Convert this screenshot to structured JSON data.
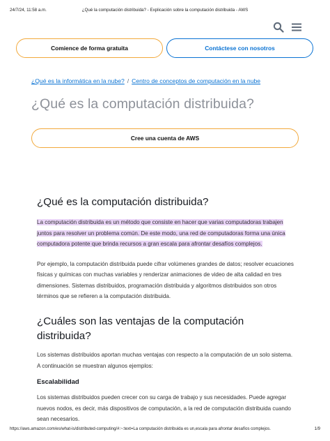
{
  "print_header": {
    "date": "24/7/24, 11:58 a.m.",
    "title": "¿Qué la computación distribuida? - Explicación sobre la computación distribuida - AWS"
  },
  "icons": {
    "search": "search-icon",
    "menu": "hamburger-menu-icon"
  },
  "cta": {
    "primary_label": "Comience de forma gratuita",
    "secondary_label": "Contáctese con nosotros"
  },
  "breadcrumb": {
    "item1": "¿Qué es la informática en la nube?",
    "separator": "/",
    "item2": "Centro de conceptos de computación en la nube"
  },
  "hero": {
    "title": "¿Qué es la computación distribuida?",
    "account_button": "Cree una cuenta de AWS"
  },
  "section1": {
    "heading": "¿Qué es la computación distribuida?",
    "highlighted_paragraph": "La computación distribuida es un método que consiste en hacer que varias computadoras trabajen juntos para resolver un problema común. De este modo, una red de computadoras forma una única computadora potente que brinda recursos a gran escala para afrontar desafíos complejos.",
    "paragraph2": "Por ejemplo, la computación distribuida puede cifrar volúmenes grandes de datos; resolver ecuaciones físicas y químicas con muchas variables y renderizar animaciones de video de alta calidad en tres dimensiones. Sistemas distribuidos, programación distribuida y algoritmos distribuidos son otros términos que se refieren a la computación distribuida."
  },
  "section2": {
    "heading": "¿Cuáles son las ventajas de la computación distribuida?",
    "paragraph": "Los sistemas distribuidos aportan muchas ventajas con respecto a la computación de un solo sistema. A continuación se muestran algunos ejemplos:",
    "subheading": "Escalabilidad",
    "sub_paragraph": "Los sistemas distribuidos pueden crecer con su carga de trabajo y sus necesidades. Puede agregar nuevos nodos, es decir, más dispositivos de computación, a la red de computación distribuida cuando sean necesarios."
  },
  "print_footer": {
    "url": "https://aws.amazon.com/es/what-is/distributed-computing/#:~:text=La computación distribuida es un,escala para afrontar desafíos complejos.",
    "page": "1/9"
  },
  "colors": {
    "accent_orange": "#f2a93b",
    "link_blue": "#0972d3",
    "highlight": "#e9d4f7",
    "muted_title": "#8d9199"
  }
}
